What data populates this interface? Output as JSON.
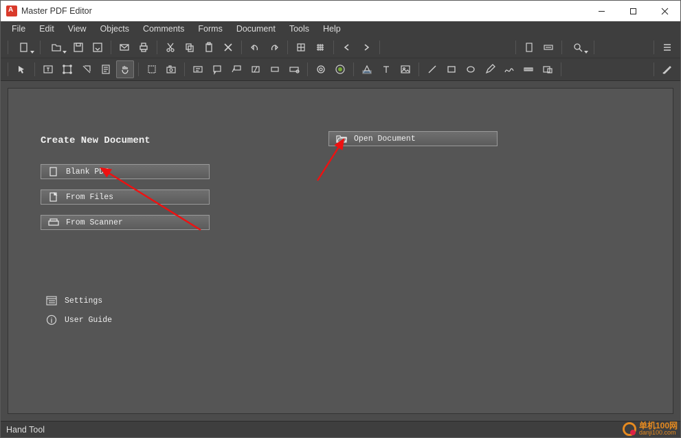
{
  "window": {
    "title": "Master PDF Editor"
  },
  "menu": {
    "file": "File",
    "edit": "Edit",
    "view": "View",
    "objects": "Objects",
    "comments": "Comments",
    "forms": "Forms",
    "document": "Document",
    "tools": "Tools",
    "help": "Help"
  },
  "start": {
    "heading": "Create New Document",
    "blank": "Blank PDF",
    "files": "From Files",
    "scanner": "From Scanner",
    "open": "Open Document",
    "settings": "Settings",
    "guide": "User Guide"
  },
  "status": {
    "tool": "Hand Tool"
  },
  "watermark": {
    "line1": "单机100网",
    "line2": "danji100.com"
  },
  "toolbar_row1": [
    "new-document",
    "open-document",
    "save",
    "save-as",
    "email",
    "print",
    "cut",
    "copy",
    "paste",
    "delete",
    "undo",
    "redo",
    "grid",
    "snap",
    "prev-page",
    "next-page",
    "first-page",
    "last-page",
    "zoom-out",
    "zoom-in",
    "options",
    "menu"
  ],
  "toolbar_row2": [
    "select",
    "edit-text",
    "edit-object",
    "edit-forms",
    "edit-document",
    "hand",
    "crop",
    "snapshot",
    "text-box",
    "sticky-note",
    "callout",
    "highlight",
    "rectangle-note",
    "link",
    "stamp",
    "attachment",
    "text-field",
    "insert-text",
    "image",
    "line",
    "rect",
    "ellipse",
    "pencil",
    "polyline",
    "polygon",
    "measure",
    "redact"
  ]
}
